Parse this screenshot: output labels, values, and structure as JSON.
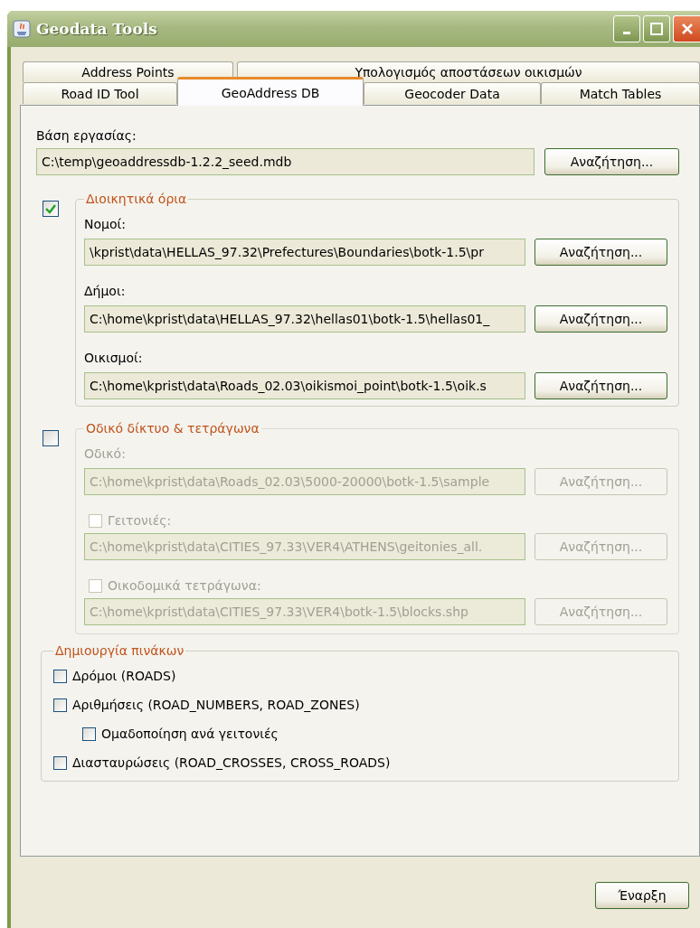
{
  "window": {
    "title": "Geodata Tools"
  },
  "tabs": [
    [
      {
        "label": "Address Points",
        "selected": false
      },
      {
        "label": "Υπολογισμός αποστάσεων οικισμών",
        "selected": false
      }
    ],
    [
      {
        "label": "Road ID Tool",
        "selected": false
      },
      {
        "label": "GeoAddress DB",
        "selected": true
      },
      {
        "label": "Geocoder Data",
        "selected": false
      },
      {
        "label": "Match Tables",
        "selected": false
      }
    ]
  ],
  "workspace": {
    "label": "Βάση εργασίας:",
    "value": "C:\\temp\\geoaddressdb-1.2.2_seed.mdb",
    "button": "Αναζήτηση..."
  },
  "groups": [
    {
      "title": "Διοικητικά όρια",
      "checked": true,
      "disabled": false,
      "fields": [
        {
          "kind": "label",
          "label": "Νομοί:",
          "value": "\\kprist\\data\\HELLAS_97.32\\Prefectures\\Boundaries\\botk-1.5\\pr",
          "button": "Αναζήτηση..."
        },
        {
          "kind": "label",
          "label": "Δήμοι:",
          "value": "C:\\home\\kprist\\data\\HELLAS_97.32\\hellas01\\botk-1.5\\hellas01_",
          "button": "Αναζήτηση..."
        },
        {
          "kind": "label",
          "label": "Οικισμοί:",
          "value": "C:\\home\\kprist\\data\\Roads_02.03\\oikismoi_point\\botk-1.5\\oik.s",
          "button": "Αναζήτηση..."
        }
      ]
    },
    {
      "title": "Οδικό δίκτυο & τετράγωνα",
      "checked": false,
      "disabled": true,
      "fields": [
        {
          "kind": "label",
          "label": "Οδικό:",
          "value": "C:\\home\\kprist\\data\\Roads_02.03\\5000-20000\\botk-1.5\\sample",
          "button": "Αναζήτηση..."
        },
        {
          "kind": "checkbox",
          "checked": false,
          "label": "Γειτονιές:",
          "value": "C:\\home\\kprist\\data\\CITIES_97.33\\VER4\\ATHENS\\geitonies_all.",
          "button": "Αναζήτηση..."
        },
        {
          "kind": "checkbox",
          "checked": false,
          "label": "Οικοδομικά τετράγωνα:",
          "value": "C:\\home\\kprist\\data\\CITIES_97.33\\VER4\\botk-1.5\\blocks.shp",
          "button": "Αναζήτηση..."
        }
      ]
    }
  ],
  "tables": {
    "title": "Δημιουργία πινάκων",
    "options": [
      {
        "label": "Δρόμοι (ROADS)",
        "checked": false
      },
      {
        "label": "Αριθμήσεις (ROAD_NUMBERS, ROAD_ZONES)",
        "checked": false,
        "children": [
          {
            "label": "Ομαδοποίηση ανά γειτονιές",
            "checked": false
          }
        ]
      },
      {
        "label": "Διασταυρώσεις (ROAD_CROSSES, CROSS_ROADS)",
        "checked": false
      }
    ]
  },
  "start_button": "Έναρξη"
}
